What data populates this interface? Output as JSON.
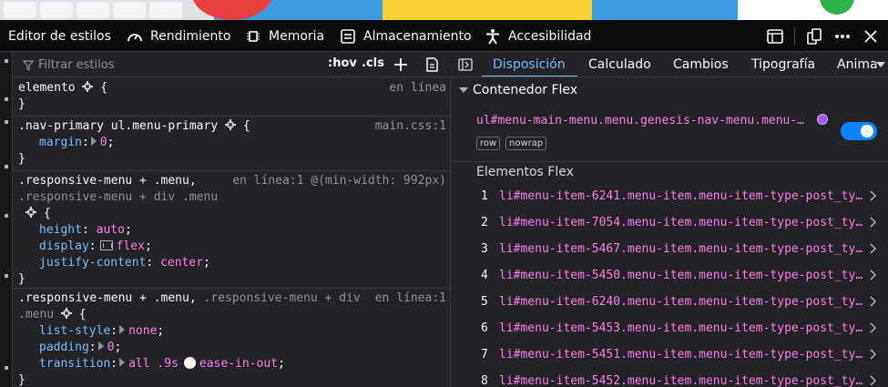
{
  "toolbar": {
    "tools": [
      {
        "label": "Editor de estilos",
        "icon": "style-editor-icon"
      },
      {
        "label": "Rendimiento",
        "icon": "performance-gauge-icon"
      },
      {
        "label": "Memoria",
        "icon": "memory-chip-icon"
      },
      {
        "label": "Almacenamiento",
        "icon": "storage-icon"
      },
      {
        "label": "Accesibilidad",
        "icon": "accessibility-icon"
      }
    ],
    "right_icons": [
      "responsive-design-icon",
      "dock-side-icon",
      "more-options-icon",
      "close-icon"
    ]
  },
  "rules_pane": {
    "filter_placeholder": "Filtrar estilos",
    "hov_label": ":hov",
    "cls_label": ".cls",
    "add_rule_icon": "plus-icon",
    "print_icon": "document-icon",
    "rules": [
      {
        "selector": "elemento",
        "source": "en línea",
        "declarations": []
      },
      {
        "selector": ".nav-primary ul.menu-primary",
        "source": "main.css:1",
        "declarations": [
          {
            "property": "margin",
            "value": "0"
          }
        ]
      },
      {
        "selector_line1": ".responsive-menu + .menu,",
        "selector_line2": ".responsive-menu + div .menu",
        "source": "en línea:1 @(min-width: 992px)",
        "declarations": [
          {
            "property": "height",
            "value": "auto"
          },
          {
            "property": "display",
            "value": "flex"
          },
          {
            "property": "justify-content",
            "value": "center"
          }
        ]
      },
      {
        "selector_line1": ".responsive-menu + .menu,",
        "selector_line1_dim": ".responsive-menu + div",
        "selector_line2": ".menu",
        "source": "en línea:1",
        "declarations": [
          {
            "property": "list-style",
            "value": "none"
          },
          {
            "property": "padding",
            "value": "0"
          },
          {
            "property": "transition",
            "value_part1": "all .9s",
            "value_part2": "ease-in-out"
          }
        ]
      }
    ],
    "open_brace": "{",
    "close_brace": "}"
  },
  "layout_pane": {
    "tabs": [
      "Disposición",
      "Calculado",
      "Cambios",
      "Tipografía",
      "Anima"
    ],
    "active_tab": "Disposición",
    "flex_section_title": "Contenedor Flex",
    "container_name": "ul#menu-main-menu.menu.genesis-nav-menu.menu-…",
    "badges": [
      "row",
      "nowrap"
    ],
    "toggle_on": true,
    "items_title": "Elementos Flex",
    "items": [
      {
        "n": "1",
        "name": "li#menu-item-6241.menu-item.menu-item-type-post_ty…"
      },
      {
        "n": "2",
        "name": "li#menu-item-7054.menu-item.menu-item-type-post_ty…"
      },
      {
        "n": "3",
        "name": "li#menu-item-5467.menu-item.menu-item-type-post_ty…"
      },
      {
        "n": "4",
        "name": "li#menu-item-5450.menu-item.menu-item-type-post_ty…"
      },
      {
        "n": "5",
        "name": "li#menu-item-6240.menu-item.menu-item-type-post_ty…"
      },
      {
        "n": "6",
        "name": "li#menu-item-5453.menu-item.menu-item-type-post_ty…"
      },
      {
        "n": "7",
        "name": "li#menu-item-5451.menu-item.menu-item-type-post_ty…"
      },
      {
        "n": "8",
        "name": "li#menu-item-5452.menu-item.menu-item-type-post_ty…"
      }
    ]
  },
  "colors": {
    "accent": "#75bfff",
    "value": "#ff7de9",
    "property": "#75bfff",
    "toggle": "#0a84ff"
  }
}
